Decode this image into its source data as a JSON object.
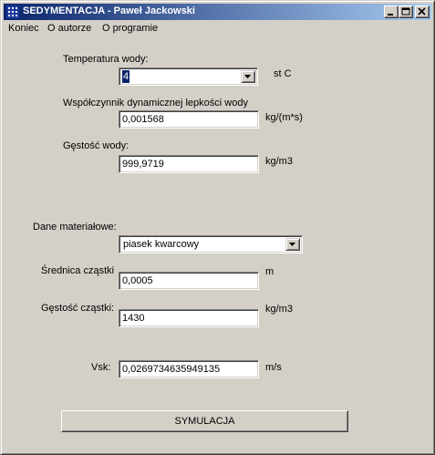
{
  "window": {
    "title": "SEDYMENTACJA - Paweł Jackowski",
    "icon": "app-grid-icon"
  },
  "menu": {
    "items": [
      "Koniec",
      "O autorze",
      "O programie"
    ]
  },
  "water": {
    "temperature_label": "Temperatura wody:",
    "temperature_value": "4",
    "temperature_unit": "st C",
    "viscosity_label": "Współczynnik dynamicznej lepkości wody",
    "viscosity_value": "0,001568",
    "viscosity_unit": "kg/(m*s)",
    "density_label": "Gęstość wody:",
    "density_value": "999,9719",
    "density_unit": "kg/m3"
  },
  "material": {
    "section_label": "Dane materiałowe:",
    "material_value": "piasek kwarcowy",
    "diameter_label": "Średnica cząstki",
    "diameter_value": "0,0005",
    "diameter_unit": "m",
    "particle_density_label": "Gęstość cząstki:",
    "particle_density_value": "1430",
    "particle_density_unit": "kg/m3"
  },
  "result": {
    "vsk_label": "Vsk:",
    "vsk_value": "0,0269734635949135",
    "vsk_unit": "m/s"
  },
  "actions": {
    "simulate_label": "SYMULACJA"
  },
  "colors": {
    "title_active_start": "#0a246a",
    "title_active_end": "#a6caf0",
    "face": "#d4d0c8",
    "selection": "#0a246a"
  }
}
